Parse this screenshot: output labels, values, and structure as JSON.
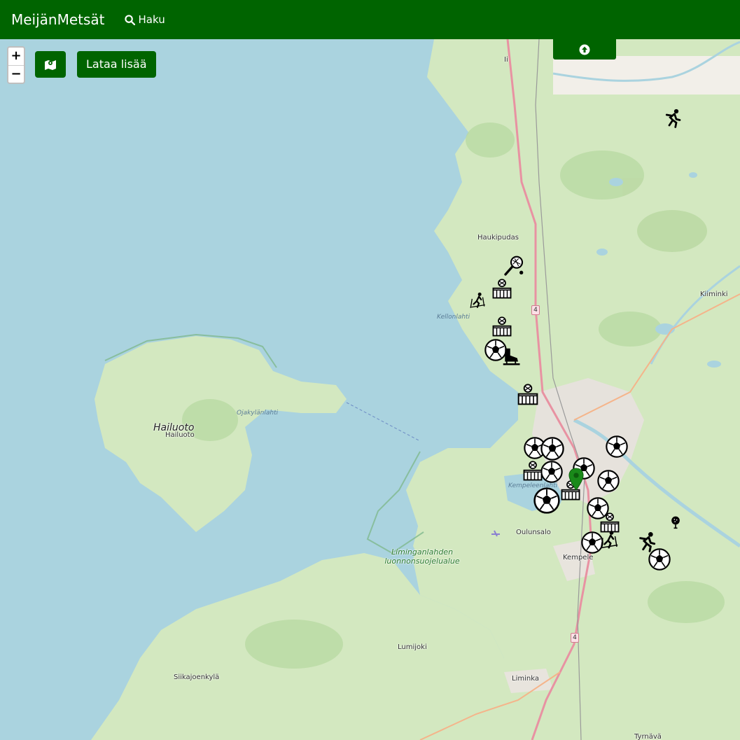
{
  "navbar": {
    "brand": "MeijänMetsät",
    "search_label": "Haku"
  },
  "controls": {
    "zoom_in": "+",
    "zoom_out": "−",
    "load_more_label": "Lataa lisää",
    "layers_icon": "map-layers-icon",
    "scroll_top_icon": "arrow-up-circle-icon"
  },
  "colors": {
    "brand_green": "#006400",
    "sea": "#aad3df",
    "land": "#f2efe9",
    "forest": "#c8e2b3",
    "motorway": "#e892a2"
  },
  "places": {
    "ii": "Ii",
    "haukipudas": "Haukipudas",
    "kiiminki": "Kiiminki",
    "kellonlahti": "Kellonlahti",
    "hailuoto_big": "Hailuoto",
    "hailuoto_small": "Hailuoto",
    "ojakylanlahti": "Ojakylänlahti",
    "kempeleenlahti": "Kempeleenlahti",
    "liminganlahti": "Liminganlahden luonnonsuojelualue",
    "oulunsalo": "Oulunsalo",
    "kempele": "Kempele",
    "lumijoki": "Lumijoki",
    "siikajoenkyla": "Siikajoenkylä",
    "liminka": "Liminka",
    "tyrnava": "Tyrnävä"
  },
  "road_shields": [
    "4",
    "4"
  ],
  "markers": [
    {
      "icon": "running-icon"
    },
    {
      "icon": "tennis-icon"
    },
    {
      "icon": "sports-hall-icon"
    },
    {
      "icon": "skiing-icon"
    },
    {
      "icon": "sports-hall-icon"
    },
    {
      "icon": "football-icon"
    },
    {
      "icon": "ice-skate-icon"
    },
    {
      "icon": "sports-hall-icon"
    },
    {
      "icon": "football-icon"
    },
    {
      "icon": "football-icon"
    },
    {
      "icon": "football-icon"
    },
    {
      "icon": "football-icon"
    },
    {
      "icon": "football-icon"
    },
    {
      "icon": "football-icon"
    },
    {
      "icon": "sports-hall-icon"
    },
    {
      "icon": "football-icon"
    },
    {
      "icon": "football-icon"
    },
    {
      "icon": "football-icon"
    },
    {
      "icon": "sports-hall-icon"
    },
    {
      "icon": "golf-icon"
    },
    {
      "icon": "running-icon"
    },
    {
      "icon": "football-icon"
    },
    {
      "icon": "skiing-icon"
    },
    {
      "icon": "sports-hall-icon"
    },
    {
      "icon": "location-pin-icon"
    }
  ]
}
